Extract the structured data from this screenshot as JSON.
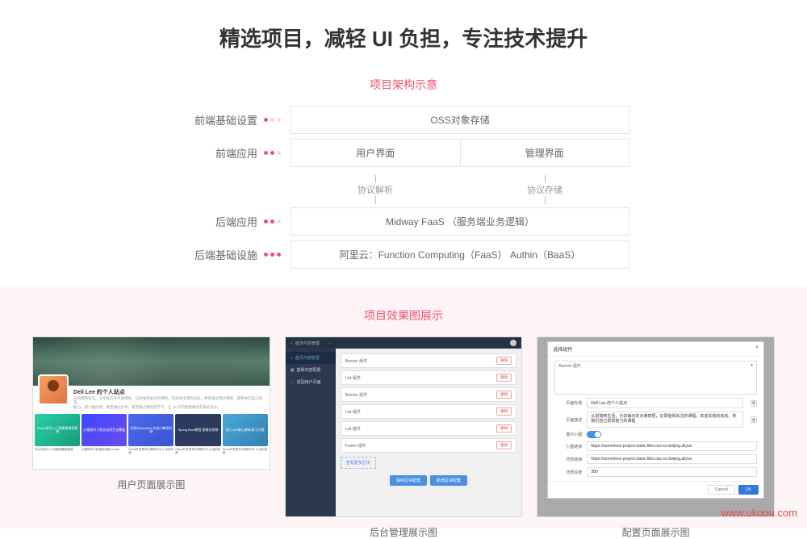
{
  "title": "精选项目，减轻 UI 负担，专注技术提升",
  "sections": {
    "arch_title": "项目架构示意",
    "gallery_title": "项目效果图展示"
  },
  "arch": {
    "rows": [
      {
        "label": "前端基础设置",
        "cells": [
          "OSS对象存储"
        ]
      },
      {
        "label": "前端应用",
        "cells": [
          "用户界面",
          "管理界面"
        ]
      },
      {
        "label": "后端应用",
        "cells": [
          "Midway FaaS  （服务端业务逻辑）"
        ]
      },
      {
        "label": "后端基础设施",
        "cells": [
          "阿里云：Function Computing（FaaS）    Authin（BaaS）"
        ]
      }
    ],
    "connectors": [
      "协议解析",
      "协议存储"
    ]
  },
  "gallery": {
    "items": [
      {
        "caption": "用户页面展示图"
      },
      {
        "caption": "后台管理展示图"
      },
      {
        "caption": "配置页面展示图"
      }
    ]
  },
  "thumb1": {
    "name": "Dell Lee 的个人站点",
    "desc1": "从前端到生活，分享每天的点滴感悟，记录值得关注的课程。欢迎关注我的动态，希望通过我的课程，能帮你们自己发现",
    "desc2": "能力，减少挫折感。希望通过分享，希望通过课程的学习，让 15 岁的我能做到开发的天才。",
    "cards": [
      "React系列入门到精通课程套装",
      "从基础学习到实战项目全覆盖",
      "社群Webpack4 实战小教程完结",
      "Spring Boot教程 套餐式系统",
      "深入Vue核心源码/复习大赛"
    ],
    "meta_title": [
      "React系列入门到精通课程套装",
      "从基础学习到源码深度Level.js",
      "React开发类专向源码BSS 从浅到深度",
      "React开发类专向源码BSS 从浅到深度",
      "React开发类专向源码BSS 从浅到深度"
    ]
  },
  "thumb2": {
    "top": "首页内容管理",
    "back": "←",
    "side": [
      "首页内容管理",
      "基础内容配置",
      "返回用户页面"
    ],
    "list": [
      "Banner 组件",
      "List 组件",
      "Banner 组件",
      "List 组件",
      "List 组件",
      "Footer 组件"
    ],
    "del": "删除",
    "link": "查看更多区块",
    "foot": [
      "保存区块配置",
      "新增区块配置"
    ]
  },
  "thumb3": {
    "title": "选择组件",
    "close": "×",
    "select": {
      "label": "",
      "value": "Banner 组件",
      "arrow": "▾"
    },
    "fields": {
      "page_title": {
        "label": "页面标题",
        "value": "Dell Lee 的个人站点"
      },
      "page_desc": {
        "label": "页面描述",
        "value": "从前端到生活，分享每天的点滴感悟，记录值得关注的课程。欢迎关我的动态，你我们自己发现能力的课程"
      },
      "show_small": {
        "label": "展示小图"
      },
      "small_link": {
        "label": "小图链接",
        "value": "https://serverless-project-static-files.oss-cn-beijing.aliyun"
      },
      "bg_link": {
        "label": "背景链接",
        "value": "https://serverless-project-static-files.oss-cn-beijing.aliyun"
      },
      "bg_height": {
        "label": "背景高度",
        "value": "380"
      }
    },
    "cancel": "Cancel",
    "ok": "OK"
  },
  "watermark": "www.ukoou.com"
}
